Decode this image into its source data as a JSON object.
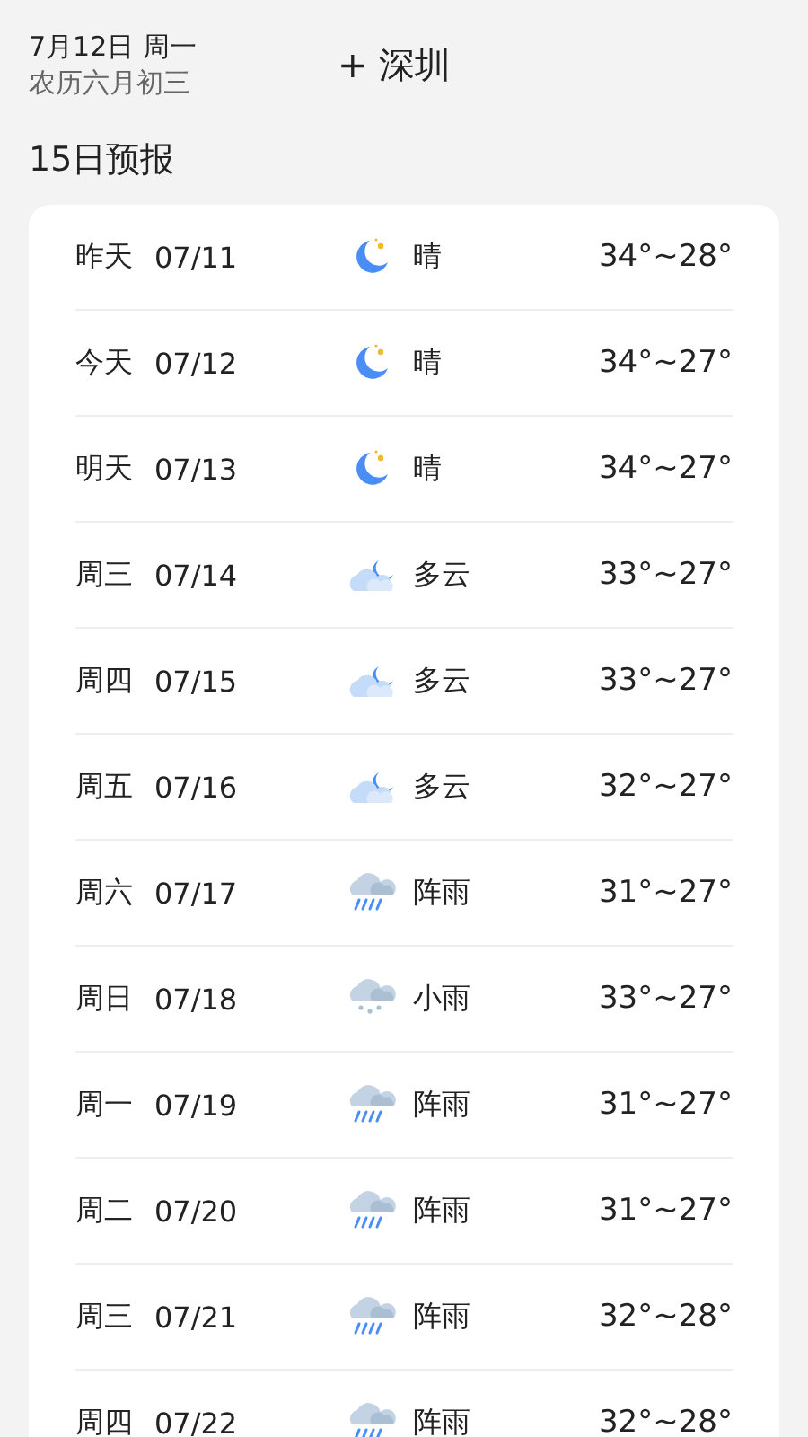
{
  "header": {
    "date": "7月12日 周一",
    "lunar": "农历六月初三",
    "add_icon": "+",
    "city": "深圳"
  },
  "forecast": {
    "title": "15日预报",
    "days": [
      {
        "day": "昨天",
        "date": "07/11",
        "kind": "clear-night",
        "condition": "晴",
        "temp": "34°~28°"
      },
      {
        "day": "今天",
        "date": "07/12",
        "kind": "clear-night",
        "condition": "晴",
        "temp": "34°~27°"
      },
      {
        "day": "明天",
        "date": "07/13",
        "kind": "clear-night",
        "condition": "晴",
        "temp": "34°~27°"
      },
      {
        "day": "周三",
        "date": "07/14",
        "kind": "cloudy-night",
        "condition": "多云",
        "temp": "33°~27°"
      },
      {
        "day": "周四",
        "date": "07/15",
        "kind": "cloudy-night",
        "condition": "多云",
        "temp": "33°~27°"
      },
      {
        "day": "周五",
        "date": "07/16",
        "kind": "cloudy-night",
        "condition": "多云",
        "temp": "32°~27°"
      },
      {
        "day": "周六",
        "date": "07/17",
        "kind": "shower",
        "condition": "阵雨",
        "temp": "31°~27°"
      },
      {
        "day": "周日",
        "date": "07/18",
        "kind": "light-rain",
        "condition": "小雨",
        "temp": "33°~27°"
      },
      {
        "day": "周一",
        "date": "07/19",
        "kind": "shower",
        "condition": "阵雨",
        "temp": "31°~27°"
      },
      {
        "day": "周二",
        "date": "07/20",
        "kind": "shower",
        "condition": "阵雨",
        "temp": "31°~27°"
      },
      {
        "day": "周三",
        "date": "07/21",
        "kind": "shower",
        "condition": "阵雨",
        "temp": "32°~28°"
      },
      {
        "day": "周四",
        "date": "07/22",
        "kind": "shower",
        "condition": "阵雨",
        "temp": "32°~28°"
      }
    ]
  }
}
